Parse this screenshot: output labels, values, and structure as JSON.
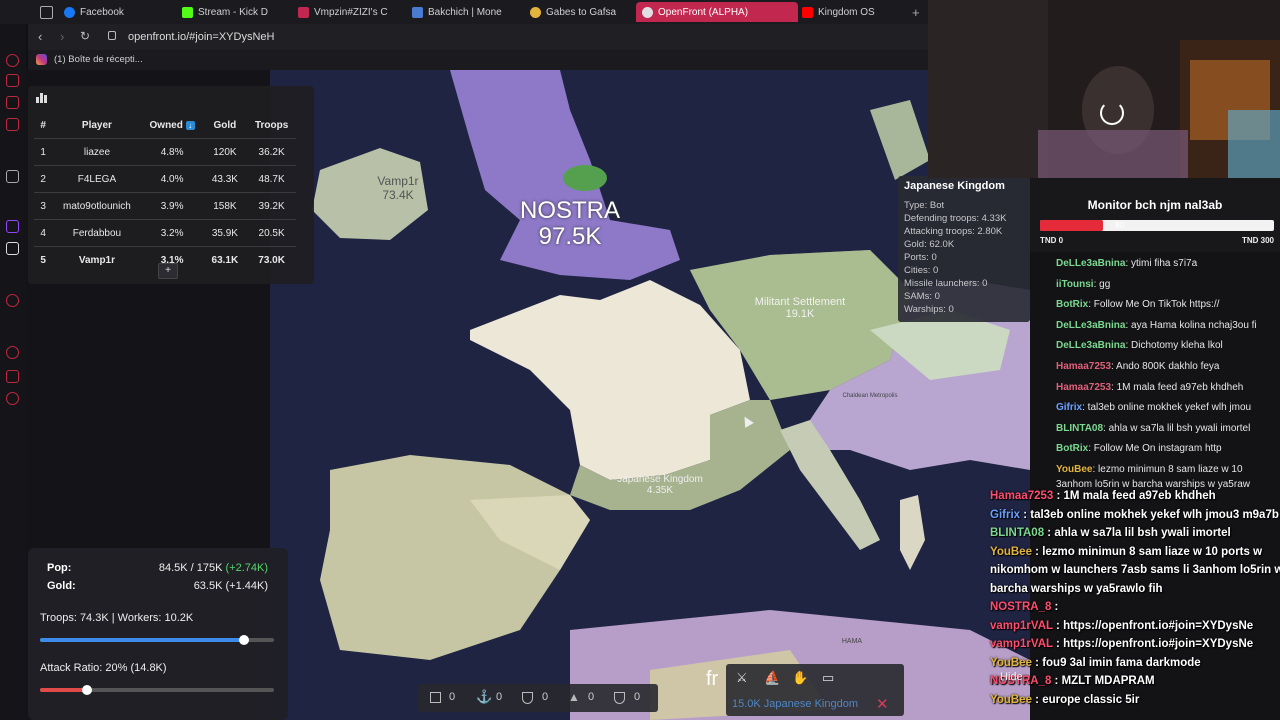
{
  "tabs": [
    {
      "label": "Facebook",
      "color": "#1877f2"
    },
    {
      "label": "Stream - Kick D",
      "color": "#53fc18"
    },
    {
      "label": "Vmpzin#ZIZI's C",
      "color": "#c2274f"
    },
    {
      "label": "Bakchich | Mone",
      "color": "#4a7bd0"
    },
    {
      "label": "Gabes to Gafsa",
      "color": "#e2b43c"
    },
    {
      "label": "OpenFront (ALPHA)",
      "color": "#e0e0e0"
    },
    {
      "label": "Kingdom OS",
      "color": "#ff0000"
    }
  ],
  "address": {
    "url": "openfront.io/#join=XYDysNeH"
  },
  "bookmark": {
    "label": "(1) Boîte de récepti..."
  },
  "leaderboard": {
    "headers": [
      "#",
      "Player",
      "Owned",
      "Gold",
      "Troops"
    ],
    "rows": [
      [
        "1",
        "liazee",
        "4.8%",
        "120K",
        "36.2K"
      ],
      [
        "2",
        "F4LEGA",
        "4.0%",
        "43.3K",
        "48.7K"
      ],
      [
        "3",
        "mato9otlounich",
        "3.9%",
        "158K",
        "39.2K"
      ],
      [
        "4",
        "Ferdabbou",
        "3.2%",
        "35.9K",
        "20.5K"
      ],
      [
        "5",
        "Vamp1r",
        "3.1%",
        "63.1K",
        "73.0K"
      ]
    ],
    "expand": "+"
  },
  "stats": {
    "pop_label": "Pop:",
    "pop_value": "84.5K / 175K",
    "pop_delta": "(+2.74K)",
    "gold_label": "Gold:",
    "gold_value": "63.5K (+1.44K)",
    "troops_line": "Troops: 74.3K | Workers: 10.2K",
    "troops_ratio": 0.87,
    "attack_line": "Attack Ratio: 20% (14.8K)",
    "attack_ratio": 0.2
  },
  "map": {
    "nostra_name": "NOSTRA",
    "nostra_troops": "97.5K",
    "vamp_name": "Vamp1r",
    "vamp_troops": "73.4K",
    "militant_name": "Militant Settlement",
    "militant_troops": "19.1K",
    "japanese_name": "Japanese Kingdom",
    "japanese_troops": "4.35K",
    "chaldean_name": "Chaldean Metropolis",
    "hama_name": "HAMA",
    "fr_text": "fr"
  },
  "tooltip": {
    "title": "Japanese Kingdom",
    "lines": [
      "Type: Bot",
      "Defending troops: 4.33K",
      "Attacking troops: 2.80K",
      "Gold: 62.0K",
      "Ports: 0",
      "Cities: 0",
      "Missile launchers: 0",
      "SAMs: 0",
      "Warships: 0"
    ]
  },
  "bottombar": {
    "counts": [
      "0",
      "0",
      "0",
      "0",
      "0"
    ]
  },
  "target": {
    "label": "15.0K Japanese Kingdom"
  },
  "hide_label": "Hide",
  "monitor": {
    "title": "Monitor bch njm nal3ab",
    "value": "80",
    "min": "TND 0",
    "max": "TND 300",
    "fill": 0.27
  },
  "chat": [
    {
      "user": "DeLLe3aBnina",
      "color": "#7bd88f",
      "text": "ytimi fiha s7i7a"
    },
    {
      "user": "iiTounsi",
      "color": "#7bd88f",
      "text": "gg"
    },
    {
      "user": "BotRix",
      "color": "#7bd88f",
      "text": "Follow Me On TikTok https://"
    },
    {
      "user": "DeLLe3aBnina",
      "color": "#7bd88f",
      "text": "aya Hama kolina nchaj3ou fi"
    },
    {
      "user": "DeLLe3aBnina",
      "color": "#7bd88f",
      "text": "Dichotomy kleha lkol"
    },
    {
      "user": "Hamaa7253",
      "color": "#e0607a",
      "text": "Ando 800K dakhlo feya"
    },
    {
      "user": "Hamaa7253",
      "color": "#e0607a",
      "text": "1M mala feed a97eb khdheh"
    },
    {
      "user": "Gifrix",
      "color": "#6aa0ff",
      "text": "tal3eb online mokhek yekef wlh jmou"
    },
    {
      "user": "BLINTA08",
      "color": "#7bd88f",
      "text": "ahla w sa7la lil bsh ywali imortel"
    },
    {
      "user": "BotRix",
      "color": "#7bd88f",
      "text": "Follow Me On instagram http"
    },
    {
      "user": "YouBee",
      "color": "#e2b43c",
      "text": "lezmo minimun 8 sam liaze w 10"
    }
  ],
  "chat_wrap": "3anhom lo5rin w barcha warships w ya5raw",
  "overlay_chat": [
    {
      "user": "Hamaa7253",
      "color": "#ff4d6d",
      "text": "1M mala feed a97eb khdheh"
    },
    {
      "user": "Gifrix",
      "color": "#6aa0ff",
      "text": "tal3eb online mokhek yekef wlh jmou3 m9a7b"
    },
    {
      "user": "BLINTA08",
      "color": "#7bd88f",
      "text": "ahla w sa7la lil bsh ywali imortel"
    },
    {
      "user": "YouBee",
      "color": "#e2b43c",
      "text": "lezmo minimun 8 sam liaze w 10 ports w"
    },
    {
      "user": "",
      "color": "#fff",
      "text": "nikomhom w launchers 7asb sams li 3anhom lo5rin w"
    },
    {
      "user": "",
      "color": "#fff",
      "text": "barcha warships w ya5rawlo fih"
    },
    {
      "user": "NOSTRA_8",
      "color": "#ff4d6d",
      "text": ""
    },
    {
      "user": "vamp1rVAL",
      "color": "#ff4d6d",
      "text": "https://openfront.io#join=XYDysNe"
    },
    {
      "user": "vamp1rVAL",
      "color": "#ff4d6d",
      "text": "https://openfront.io#join=XYDysNe"
    },
    {
      "user": "YouBee",
      "color": "#e2b43c",
      "text": "fou9 3al imin fama darkmode"
    },
    {
      "user": "NOSTRA_8",
      "color": "#ff4d6d",
      "text": "MZLT MDAPRAM"
    },
    {
      "user": "YouBee",
      "color": "#e2b43c",
      "text": "europe classic 5ir"
    }
  ]
}
